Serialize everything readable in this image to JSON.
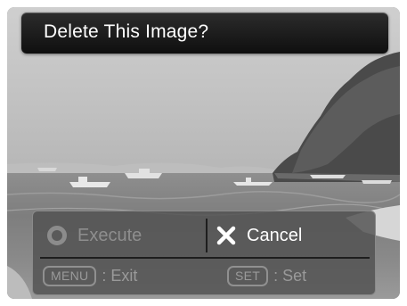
{
  "title": "Delete This Image?",
  "options": {
    "execute": {
      "label": "Execute",
      "selected": false,
      "icon": "radio-ring-icon"
    },
    "cancel": {
      "label": "Cancel",
      "selected": true,
      "icon": "x-icon"
    }
  },
  "hints": {
    "exit": {
      "key": "MENU",
      "text": ": Exit"
    },
    "set": {
      "key": "SET",
      "text": ": Set"
    }
  }
}
